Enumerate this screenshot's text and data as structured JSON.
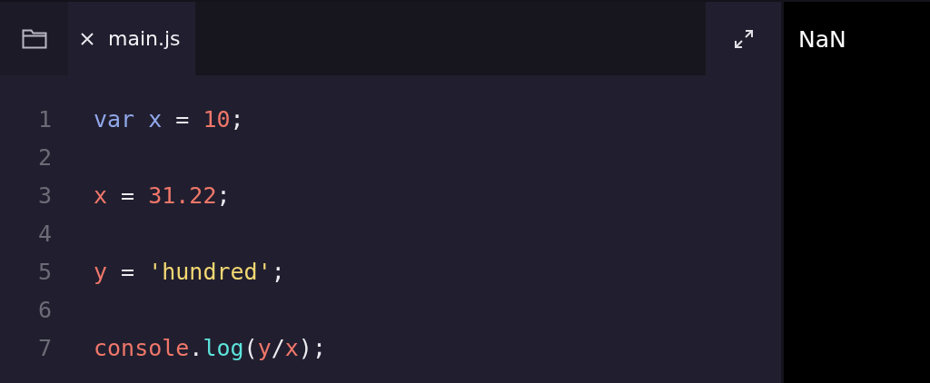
{
  "tabs": [
    {
      "label": "main.js",
      "selected": true
    }
  ],
  "editor": {
    "lines": [
      {
        "number": "1",
        "tokens": [
          {
            "kind": "keyword",
            "text": "var "
          },
          {
            "kind": "declared",
            "text": "x"
          },
          {
            "kind": "plain",
            "text": " = "
          },
          {
            "kind": "number",
            "text": "10"
          },
          {
            "kind": "plain",
            "text": ";"
          }
        ]
      },
      {
        "number": "2"
      },
      {
        "number": "3",
        "tokens": [
          {
            "kind": "identifier",
            "text": "x"
          },
          {
            "kind": "plain",
            "text": " = "
          },
          {
            "kind": "number",
            "text": "31.22"
          },
          {
            "kind": "plain",
            "text": ";"
          }
        ]
      },
      {
        "number": "4"
      },
      {
        "number": "5",
        "tokens": [
          {
            "kind": "identifier",
            "text": "y"
          },
          {
            "kind": "plain",
            "text": " = "
          },
          {
            "kind": "string",
            "text": "'hundred'"
          },
          {
            "kind": "plain",
            "text": ";"
          }
        ]
      },
      {
        "number": "6"
      },
      {
        "number": "7",
        "tokens": [
          {
            "kind": "identifier",
            "text": "console"
          },
          {
            "kind": "plain",
            "text": "."
          },
          {
            "kind": "method",
            "text": "log"
          },
          {
            "kind": "plain",
            "text": "("
          },
          {
            "kind": "identifier",
            "text": "y"
          },
          {
            "kind": "plain",
            "text": "/"
          },
          {
            "kind": "identifier",
            "text": "x"
          },
          {
            "kind": "plain",
            "text": ");"
          }
        ]
      }
    ]
  },
  "output": {
    "text": "NaN"
  }
}
